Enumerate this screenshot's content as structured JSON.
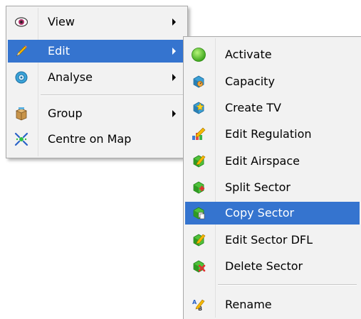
{
  "main_menu": {
    "items": [
      {
        "label": "View",
        "icon": "eye-icon",
        "submenu": true
      },
      {
        "label": "Edit",
        "icon": "pencil-icon",
        "submenu": true,
        "highlighted": true
      },
      {
        "label": "Analyse",
        "icon": "gear-icon",
        "submenu": true
      },
      {
        "label": "Group",
        "icon": "box-icon",
        "submenu": true
      },
      {
        "label": "Centre on Map",
        "icon": "centre-icon",
        "submenu": false
      }
    ]
  },
  "sub_menu": {
    "items": [
      {
        "label": "Activate",
        "icon": "green-circle-icon"
      },
      {
        "label": "Capacity",
        "icon": "capacity-icon"
      },
      {
        "label": "Create TV",
        "icon": "create-tv-icon"
      },
      {
        "label": "Edit Regulation",
        "icon": "edit-regulation-icon"
      },
      {
        "label": "Edit Airspace",
        "icon": "edit-airspace-icon"
      },
      {
        "label": "Split Sector",
        "icon": "split-sector-icon"
      },
      {
        "label": "Copy Sector",
        "icon": "copy-sector-icon",
        "highlighted": true
      },
      {
        "label": "Edit Sector DFL",
        "icon": "edit-sector-dfl-icon"
      },
      {
        "label": "Delete Sector",
        "icon": "delete-sector-icon"
      },
      {
        "label": "Rename",
        "icon": "rename-icon"
      }
    ]
  },
  "colors": {
    "menu_background": "#f2f2f2",
    "highlight": "#3574cf",
    "highlight_text": "#ffffff"
  }
}
